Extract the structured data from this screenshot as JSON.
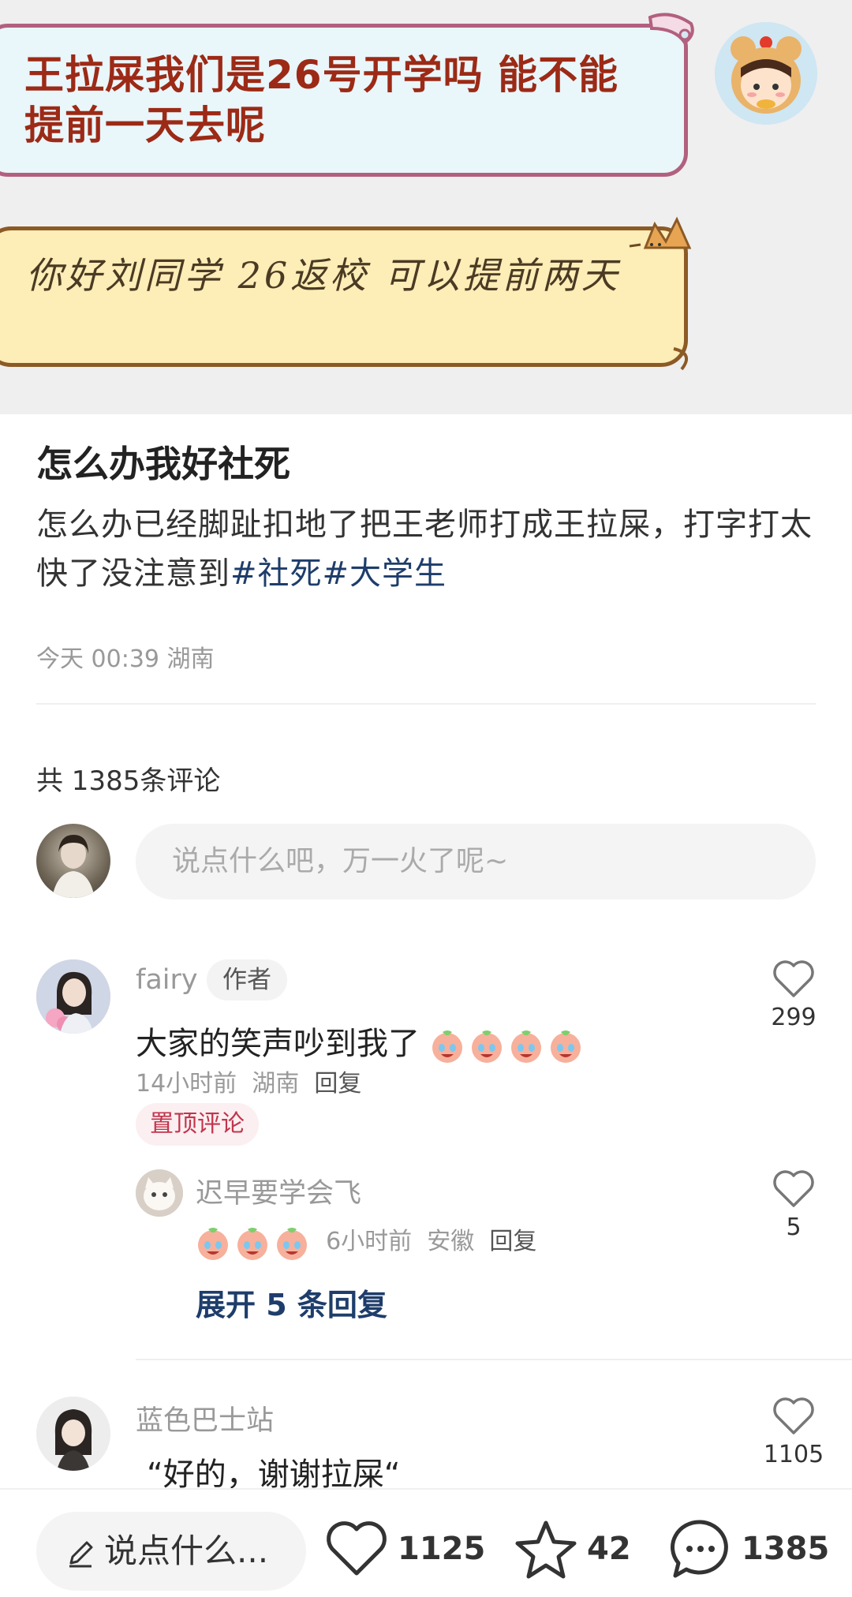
{
  "chat": {
    "message_incoming": "王拉屎我们是26号开学吗 能不能提前一天去呢",
    "message_reply": "你好刘同学 26返校 可以提前两天"
  },
  "post": {
    "title": "怎么办我好社死",
    "body": "怎么办已经脚趾扣地了把王老师打成王拉屎，打字打太快了没注意到",
    "tags": [
      "#社死",
      "#大学生"
    ],
    "time": "今天 00:39",
    "location": "湖南"
  },
  "comments_section": {
    "count_label": "共 1385条评论",
    "input_placeholder": "说点什么吧，万一火了呢~"
  },
  "comments": [
    {
      "name": "fairy",
      "badge": "作者",
      "text": "大家的笑声吵到我了",
      "time": "14小时前",
      "location": "湖南",
      "reply_label": "回复",
      "pinned_label": "置顶评论",
      "likes": "299"
    },
    {
      "name": "蓝色巴士站",
      "text": "“好的，谢谢拉屎“",
      "likes": "1105"
    }
  ],
  "reply": {
    "name": "迟早要学会飞",
    "time": "6小时前",
    "location": "安徽",
    "reply_label": "回复",
    "likes": "5",
    "expand_label": "展开 5 条回复"
  },
  "bottom_bar": {
    "input_label": "说点什么...",
    "likes": "1125",
    "favorites": "42",
    "comments": "1385"
  },
  "colors": {
    "tag": "#1e3d6b",
    "pinned": "#c2354d",
    "chat_bg": "#efeff0"
  }
}
